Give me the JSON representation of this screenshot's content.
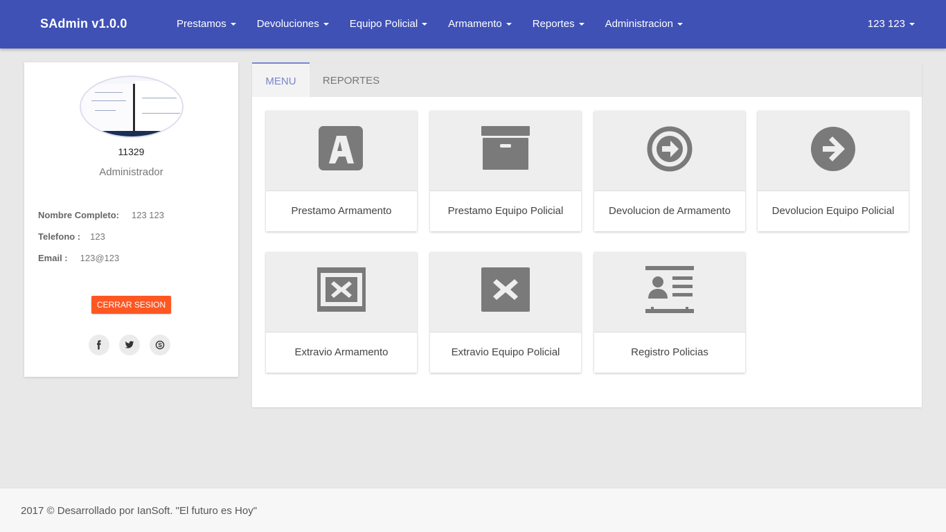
{
  "navbar": {
    "brand": "SAdmin v1.0.0",
    "menu": [
      {
        "label": "Prestamos"
      },
      {
        "label": "Devoluciones"
      },
      {
        "label": "Equipo Policial"
      },
      {
        "label": "Armamento"
      },
      {
        "label": "Reportes"
      },
      {
        "label": "Administracion"
      }
    ],
    "user": "123 123"
  },
  "profile": {
    "employee_number": "11329",
    "role": "Administrador",
    "full_name_label": "Nombre Completo:",
    "full_name": "123 123",
    "phone_label": "Telefono :",
    "phone": "123",
    "email_label": "Email :",
    "email": "123@123",
    "logout_label": "CERRAR SESION",
    "social": [
      "facebook-icon",
      "twitter-icon",
      "skype-icon"
    ]
  },
  "tabs": [
    {
      "label": "MENU",
      "active": true
    },
    {
      "label": "REPORTES",
      "active": false
    }
  ],
  "tiles": [
    {
      "label": "Prestamo Armamento",
      "icon": "letter-a-icon"
    },
    {
      "label": "Prestamo Equipo Policial",
      "icon": "archive-box-icon"
    },
    {
      "label": "Devolucion de Armamento",
      "icon": "circle-arrow-right-outline-icon"
    },
    {
      "label": "Devolucion Equipo Policial",
      "icon": "circle-arrow-right-icon"
    },
    {
      "label": "Extravio Armamento",
      "icon": "window-close-outline-icon"
    },
    {
      "label": "Extravio Equipo Policial",
      "icon": "window-close-icon"
    },
    {
      "label": "Registro Policias",
      "icon": "id-card-icon"
    }
  ],
  "footer": {
    "text": "2017 © Desarrollado por IanSoft. \"El futuro es Hoy\""
  },
  "colors": {
    "navbar": "#3f51b5",
    "accent": "#7986cb",
    "logout": "#ff5722",
    "icon": "#7a7a7a"
  }
}
